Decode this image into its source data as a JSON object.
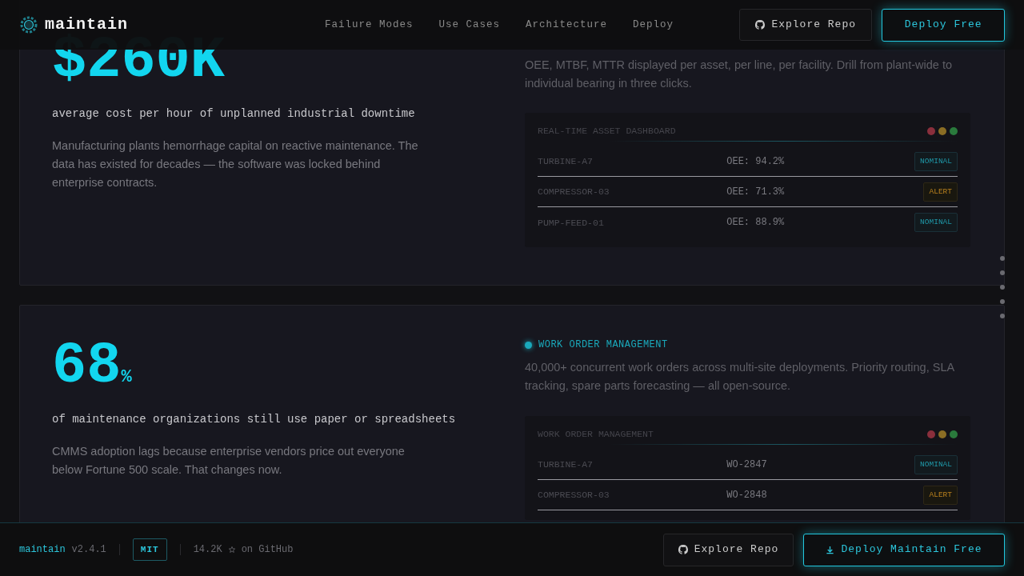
{
  "navbar": {
    "brand": "maintain",
    "links": [
      "Failure Modes",
      "Use Cases",
      "Architecture",
      "Deploy"
    ],
    "buttons": [
      {
        "label": "Explore Repo",
        "kind": "secondary"
      },
      {
        "label": "Deploy Free",
        "kind": "primary"
      }
    ]
  },
  "sections": [
    {
      "stat": "$260K",
      "caption": "average cost per hour of unplanned industrial downtime",
      "text": "Manufacturing plants hemorrhage capital on reactive maintenance. The data has existed for decades — the software was locked behind enterprise contracts.",
      "feature_text": "OEE, MTBF, MTTR displayed per asset, per line, per facility. Drill from plant-wide to individual bearing in three clicks.",
      "panel": {
        "title": "REAL-TIME ASSET DASHBOARD",
        "rows": [
          {
            "asset": "TURBINE-A7",
            "value": "OEE: 94.2%",
            "status": "NOMINAL",
            "kind": "nominal"
          },
          {
            "asset": "COMPRESSOR-03",
            "value": "OEE: 71.3%",
            "status": "ALERT",
            "kind": "alert"
          },
          {
            "asset": "PUMP-FEED-01",
            "value": "OEE: 88.9%",
            "status": "NOMINAL",
            "kind": "nominal"
          }
        ]
      }
    },
    {
      "stat": "68",
      "stat_suffix": "%",
      "caption": "of maintenance organizations still use paper or spreadsheets",
      "text": "CMMS adoption lags because enterprise vendors price out everyone below Fortune 500 scale. That changes now.",
      "feature_tag": "WORK ORDER MANAGEMENT",
      "feature_text": "40,000+ concurrent work orders across multi-site deployments. Priority routing, SLA tracking, spare parts forecasting — all open-source.",
      "panel": {
        "title": "WORK ORDER MANAGEMENT",
        "rows": [
          {
            "asset": "TURBINE-A7",
            "value": "WO-2847",
            "status": "NOMINAL",
            "kind": "nominal"
          },
          {
            "asset": "COMPRESSOR-03",
            "value": "WO-2848",
            "status": "ALERT",
            "kind": "alert"
          }
        ]
      }
    }
  ],
  "section_dots": [
    {
      "selected": false
    },
    {
      "selected": false
    },
    {
      "selected": false
    },
    {
      "selected": false
    },
    {
      "selected": false
    }
  ],
  "footer": {
    "name": "maintain",
    "version": "v2.4.1",
    "license": "MIT",
    "stars": "14.2K",
    "stars_suffix": "on GitHub",
    "buttons": [
      {
        "label": "Explore Repo",
        "kind": "secondary"
      },
      {
        "label": "Deploy Maintain Free",
        "kind": "primary"
      }
    ]
  }
}
